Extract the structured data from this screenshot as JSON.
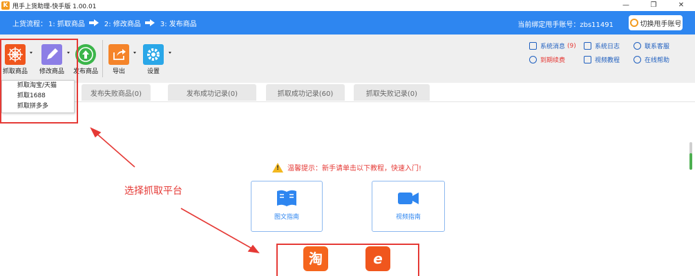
{
  "window": {
    "title": "甩手上货助理-快手版 1.00.01",
    "logo_text": "K",
    "controls": [
      "—",
      "❐",
      "✕"
    ]
  },
  "flow": {
    "label": "上货流程：",
    "steps": [
      "1: 抓取商品",
      "2: 修改商品",
      "3: 发布商品"
    ]
  },
  "account": {
    "text": "当前绑定甩手账号：zbs11491",
    "switch_label": "切换甩手账号"
  },
  "toolbar": {
    "items": [
      {
        "label": "抓取商品",
        "icon": "spider-web-icon",
        "color": "#f0561d"
      },
      {
        "label": "修改商品",
        "icon": "pencil-icon",
        "color": "#8c7ee6"
      },
      {
        "label": "发布商品",
        "icon": "upload-arrow-icon",
        "color": "#3bb54a"
      },
      {
        "label": "导出",
        "icon": "export-icon",
        "color": "#f5842a"
      },
      {
        "label": "设置",
        "icon": "gear-icon",
        "color": "#2aa7e8"
      }
    ]
  },
  "right_links": {
    "system_message": "系统消息",
    "message_count": "(9)",
    "system_log": "系统日志",
    "contact_service": "联系客服",
    "renew": "到期续费",
    "video_tutorial": "视频教程",
    "online_help": "在线帮助"
  },
  "tabs": [
    "发布失败商品(0)",
    "发布成功记录(0)",
    "抓取成功记录(60)",
    "抓取失败记录(0)"
  ],
  "dropdown": {
    "items": [
      "抓取淘宝/天猫",
      "抓取1688",
      "抓取拼多多"
    ]
  },
  "main": {
    "tip": "温馨提示：新手请单击以下教程，快速入门!",
    "guide_text": "图文指南",
    "guide_video": "视频指南",
    "annotation": "选择抓取平台",
    "platforms": [
      {
        "name": "taobao",
        "glyph": "淘",
        "color": "#f5651d"
      },
      {
        "name": "1688",
        "glyph": "e",
        "color": "#f0561d"
      }
    ]
  },
  "colors": {
    "accent": "#2e86f0",
    "highlight": "#e53935"
  }
}
